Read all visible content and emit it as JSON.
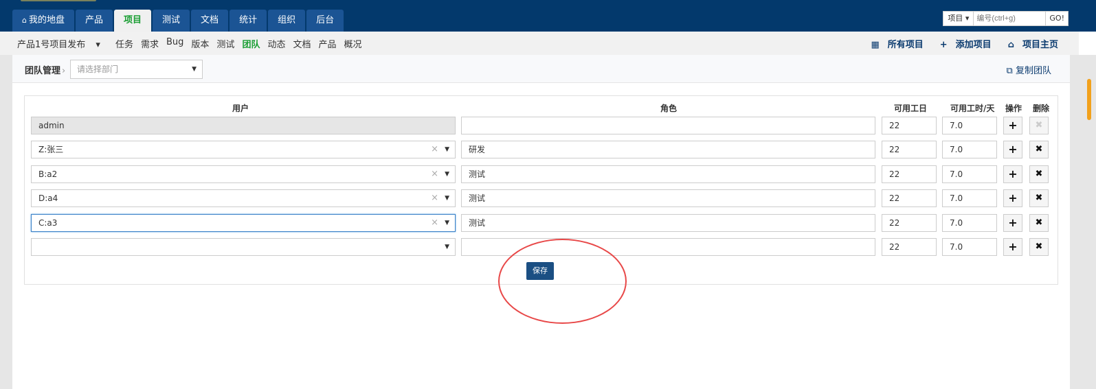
{
  "topnav": {
    "tabs": [
      "我的地盘",
      "产品",
      "项目",
      "测试",
      "文档",
      "统计",
      "组织",
      "后台"
    ],
    "active_index": 2,
    "search_type": "项目",
    "search_placeholder": "编号(ctrl+g)",
    "go_label": "GO!"
  },
  "subnav": {
    "project": "产品1号项目发布",
    "items": [
      "任务",
      "需求",
      "Bug",
      "版本",
      "测试",
      "团队",
      "动态",
      "文档",
      "产品",
      "概况"
    ],
    "active": "团队",
    "right": [
      "所有项目",
      "添加项目",
      "项目主页"
    ]
  },
  "header": {
    "title": "团队管理",
    "dept_placeholder": "请选择部门",
    "copy_label": "复制团队"
  },
  "table": {
    "columns": [
      "用户",
      "角色",
      "可用工日",
      "可用工时/天",
      "操作",
      "删除"
    ],
    "rows": [
      {
        "user": "admin",
        "role": "",
        "days": "22",
        "hours": "7.0"
      },
      {
        "user": "Z:张三",
        "role": "研发",
        "days": "22",
        "hours": "7.0"
      },
      {
        "user": "B:a2",
        "role": "测试",
        "days": "22",
        "hours": "7.0"
      },
      {
        "user": "D:a4",
        "role": "测试",
        "days": "22",
        "hours": "7.0"
      },
      {
        "user": "C:a3",
        "role": "测试",
        "days": "22",
        "hours": "7.0"
      },
      {
        "user": "",
        "role": "",
        "days": "22",
        "hours": "7.0"
      }
    ]
  },
  "save_label": "保存",
  "colors": {
    "topbar": "#03396c",
    "active_green": "#1a9e33",
    "save": "#1b4f83",
    "annotation": "#e84848"
  }
}
